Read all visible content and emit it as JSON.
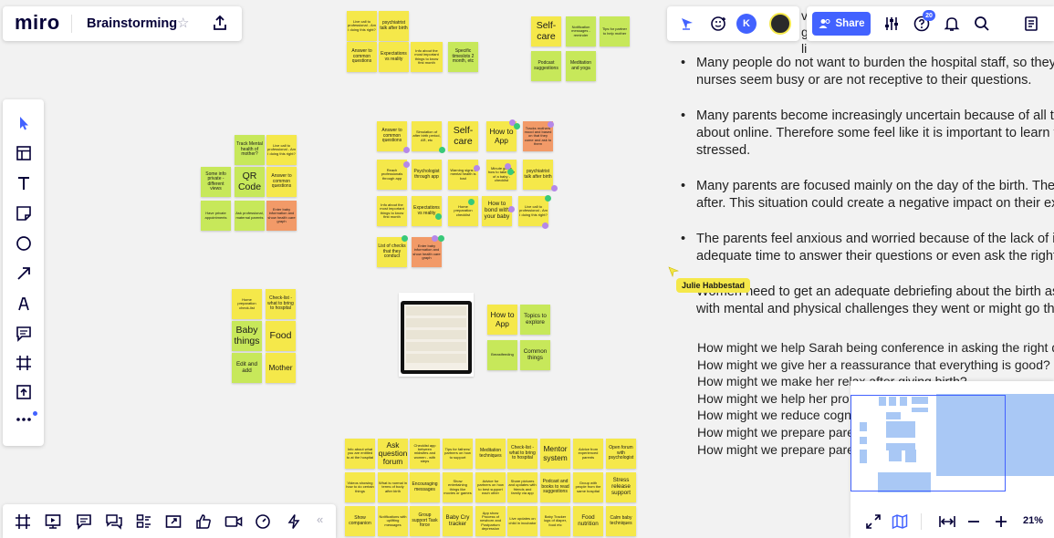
{
  "app": {
    "logo": "miro",
    "board_title": "Brainstorming",
    "star_icon": "star-icon",
    "export_icon": "upload-icon"
  },
  "topbar": {
    "avatar_letter": "K",
    "share_label": "Share",
    "help_badge": "20",
    "partial_text": "v g li"
  },
  "zoom": {
    "label": "21%"
  },
  "cursor_user": "Julie Habbestad",
  "notes": {
    "n1": "Live call to professional - Am I doing this right?",
    "n2": "psychiatrist talk after birth",
    "n3": "Answer to common questions",
    "n4": "Expectations vs reality",
    "n5": "Info about the most important things to know first month",
    "n6": "Specific timeslots 2 month, etc",
    "n7": "Self-care",
    "n8": "Notification messages - reminder",
    "n9": "Tips for partner to help mother",
    "n10": "Podcast suggestions",
    "n11": "Meditation and yoga",
    "n12": "Track Mental health of mother?",
    "n13": "Live call to professional - Am I doing this right?",
    "n14": "Some info private - different views",
    "n15": "QR Code",
    "n16": "Answer to common questions",
    "n17": "Have private appointments",
    "n18": "Ask professional, maternal parents",
    "n19": "Enter baby information and show health care graph",
    "n20": "Answer to common questions",
    "n21": "Simulation of after birth period, AR, etc",
    "n22": "Self-care",
    "n23": "How to App",
    "n24": "Tracks mothers mood and based on that they come and ask to them",
    "n25": "Reach professionals through app",
    "n26": "Psychologist through app",
    "n27": "Warning signs if mental health is bad",
    "n28": "Minute guide how to take care of a baby - checklist",
    "n29": "psychiatrist talk after birth",
    "n30": "Info about the most important things to know first month",
    "n31": "Expectations vs reality",
    "n32": "Home preparation checklist",
    "n33": "How to bond with your baby",
    "n34": "Live call to professional - Am I doing this right?",
    "n35": "List of checks that they conduct",
    "n36": "Enter baby information and show health care graph",
    "n37": "Home preparation check-list",
    "n38": "Check-list - what to bring to hospital",
    "n39": "Baby things",
    "n40": "Food",
    "n41": "Edit and add",
    "n42": "Mother",
    "n43": "How to App",
    "n44": "Topics to explore",
    "n45": "Breastfeeding",
    "n46": "Common things",
    "b1": "Info about what you are entitled to at the hospital",
    "b2": "Ask question forum",
    "b3": "Checklist app between midwifes and women - with steps",
    "b4": "Tips for fathers/ partners on how to support",
    "b5": "Meditation techniques",
    "b6": "Check-list - what to bring to hospital",
    "b7": "Mentor system",
    "b8": "Advice from experienced parents",
    "b9": "Open forum with psychologist",
    "b10": "Videos showing how to do certain things",
    "b11": "What is normal in terms of body after birth",
    "b12": "Encouraging messages",
    "b13": "Show entertaining things like movies or games",
    "b14": "Advice for partners on how to best support each other",
    "b15": "Share pictures and updates with friends and family via app",
    "b16": "Podcast and books to read suggestions",
    "b17": "Group with people from the same hospital",
    "b18": "Stress release support",
    "b19": "Show companion",
    "b20": "Notifications with uplifting messages",
    "b21": "Group support Task force",
    "b22": "Baby Cry tracker",
    "b23": "App show Process of newborn and Postpartum depression",
    "b24": "Live updates on child in incubator",
    "b25": "Baby Tracker logs of diaper, food etc",
    "b26": "Food nutrition",
    "b27": "Calm baby techniques"
  },
  "bullets": [
    {
      "l1": "Many people do not want to burden the hospital staff, so they",
      "l2": "nurses seem busy or are not receptive to their questions."
    },
    {
      "l1": "Many parents become increasingly uncertain because of all the",
      "l2": "about online. Therefore some feel like it is important to learn t",
      "l3": "stressed."
    },
    {
      "l1": "Many parents are focused mainly on the day of the birth. They",
      "l2": "after. This situation could create a negative impact on their exp"
    },
    {
      "l1": "The parents feel anxious and worried because of the lack of inf",
      "l2": "adequate time to answer their questions or even ask the right"
    },
    {
      "l1": "Women need to get an adequate debriefing about the birth as",
      "l2": "with mental and physical challenges they went or might go thro"
    }
  ],
  "hmw": [
    "How might we help Sarah being conference in asking the right q",
    "How might we give her a reassurance that everything is good?",
    "How might we make her relax after giving birth?",
    "How might we help her pro",
    "How might we reduce cogn",
    "How might we prepare pare",
    "How might we prepare pare"
  ],
  "left_tools": [
    "select-tool",
    "templates-tool",
    "text-tool",
    "sticky-note-tool",
    "shape-tool",
    "connection-line-tool",
    "pen-tool",
    "comment-tool",
    "frame-tool",
    "upload-tool",
    "more-tools"
  ],
  "bottom_tools": [
    "frames-tool",
    "presentation-tool",
    "comments-tool",
    "chat-tool",
    "cards-tool",
    "share-screen-tool",
    "voting-tool",
    "video-tool",
    "timer-tool",
    "lightning-tool",
    "collapse-chevron"
  ],
  "colors": {
    "accent": "#4262ff",
    "sticky_yellow": "#f5e84a",
    "sticky_green": "#c7e85a",
    "sticky_orange": "#f29a68",
    "canvas": "#f2f2f2"
  }
}
